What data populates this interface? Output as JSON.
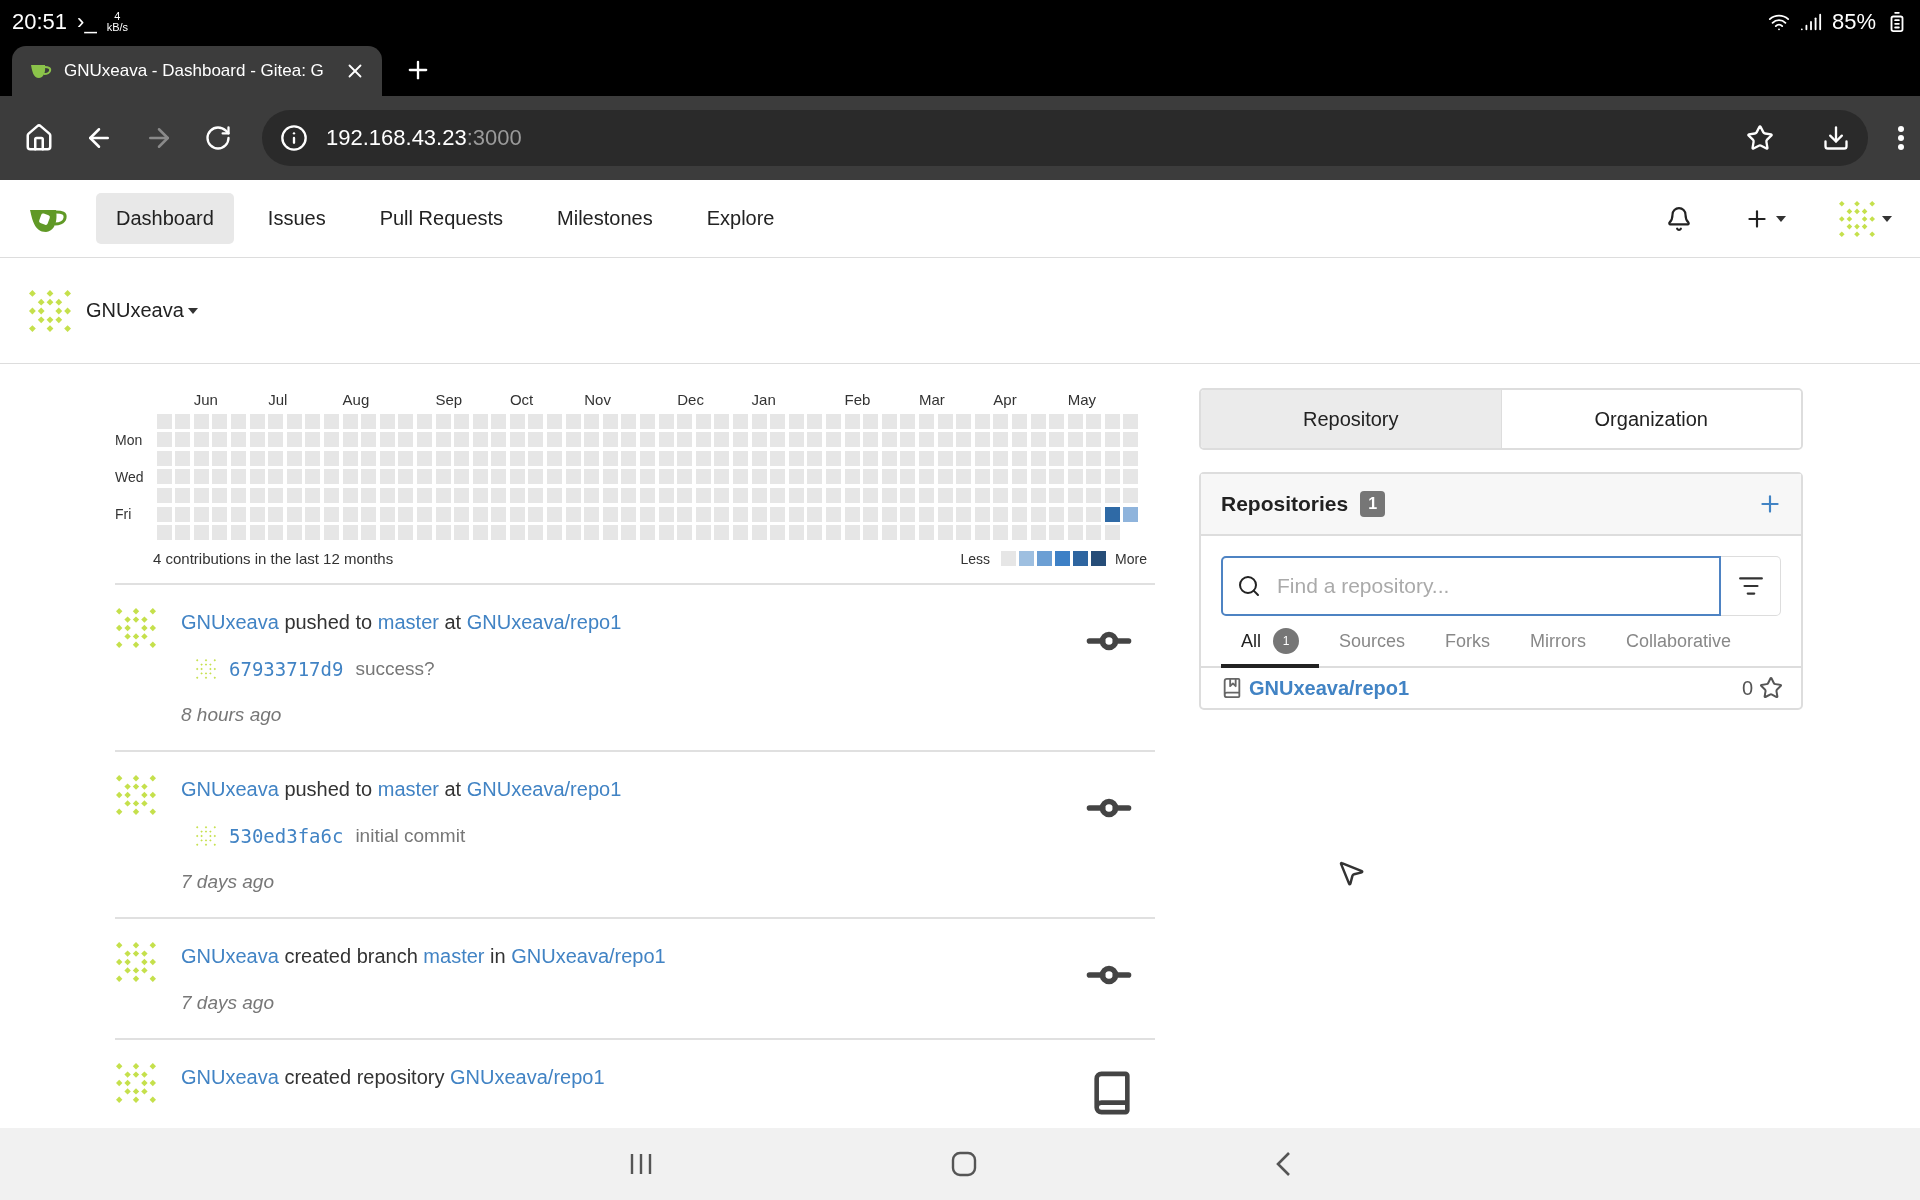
{
  "status_bar": {
    "time": "20:51",
    "prompt": "›_",
    "speed_value": "4",
    "speed_unit": "kB/s",
    "battery": "85%"
  },
  "browser": {
    "tab_title": "GNUxeava - Dashboard - Gitea: G",
    "url_host": "192.168.43.23",
    "url_port": ":3000",
    "forward_disabled": true
  },
  "nav": {
    "items": [
      {
        "label": "Dashboard",
        "selected": true
      },
      {
        "label": "Issues",
        "selected": false
      },
      {
        "label": "Pull Requests",
        "selected": false
      },
      {
        "label": "Milestones",
        "selected": false
      },
      {
        "label": "Explore",
        "selected": false
      }
    ]
  },
  "context": {
    "name": "GNUxeava"
  },
  "heatmap": {
    "months": [
      "Jun",
      "Jul",
      "Aug",
      "Sep",
      "Oct",
      "Nov",
      "Dec",
      "Jan",
      "Feb",
      "Mar",
      "Apr",
      "May"
    ],
    "days": [
      "Mon",
      "Wed",
      "Fri"
    ],
    "cells": [
      {
        "color": "#2f6aa6"
      },
      {
        "color": "#8fb4dc"
      }
    ],
    "summary": "4 contributions in the last 12 months",
    "legend_less": "Less",
    "legend_more": "More"
  },
  "feed": [
    {
      "kind": "commit",
      "segments": [
        {
          "text": "GNUxeava",
          "link": true
        },
        {
          "text": "pushed to",
          "link": false
        },
        {
          "text": "master",
          "link": true
        },
        {
          "text": "at",
          "link": false
        },
        {
          "text": "GNUxeava/repo1",
          "link": true
        }
      ],
      "commits": [
        {
          "sha": "67933717d9",
          "message": "success?"
        }
      ],
      "time": "8 hours ago"
    },
    {
      "kind": "commit",
      "segments": [
        {
          "text": "GNUxeava",
          "link": true
        },
        {
          "text": "pushed to",
          "link": false
        },
        {
          "text": "master",
          "link": true
        },
        {
          "text": "at",
          "link": false
        },
        {
          "text": "GNUxeava/repo1",
          "link": true
        }
      ],
      "commits": [
        {
          "sha": "530ed3fa6c",
          "message": "initial commit"
        }
      ],
      "time": "7 days ago"
    },
    {
      "kind": "commit",
      "segments": [
        {
          "text": "GNUxeava",
          "link": true
        },
        {
          "text": "created branch",
          "link": false
        },
        {
          "text": "master",
          "link": true
        },
        {
          "text": "in",
          "link": false
        },
        {
          "text": "GNUxeava/repo1",
          "link": true
        }
      ],
      "time": "7 days ago"
    },
    {
      "kind": "repo",
      "segments": [
        {
          "text": "GNUxeava",
          "link": true
        },
        {
          "text": "created repository",
          "link": false
        },
        {
          "text": "GNUxeava/repo1",
          "link": true
        }
      ]
    }
  ],
  "sidebar": {
    "tabs": [
      {
        "label": "Repository",
        "selected": true
      },
      {
        "label": "Organization",
        "selected": false
      }
    ],
    "title": "Repositories",
    "count": "1",
    "search_placeholder": "Find a repository...",
    "filters": [
      {
        "label": "All",
        "count": "1",
        "selected": true
      },
      {
        "label": "Sources",
        "selected": false
      },
      {
        "label": "Forks",
        "selected": false
      },
      {
        "label": "Mirrors",
        "selected": false
      },
      {
        "label": "Collaborative",
        "selected": false
      }
    ],
    "repos": [
      {
        "name": "GNUxeava/repo1",
        "star_count": "0"
      }
    ]
  }
}
